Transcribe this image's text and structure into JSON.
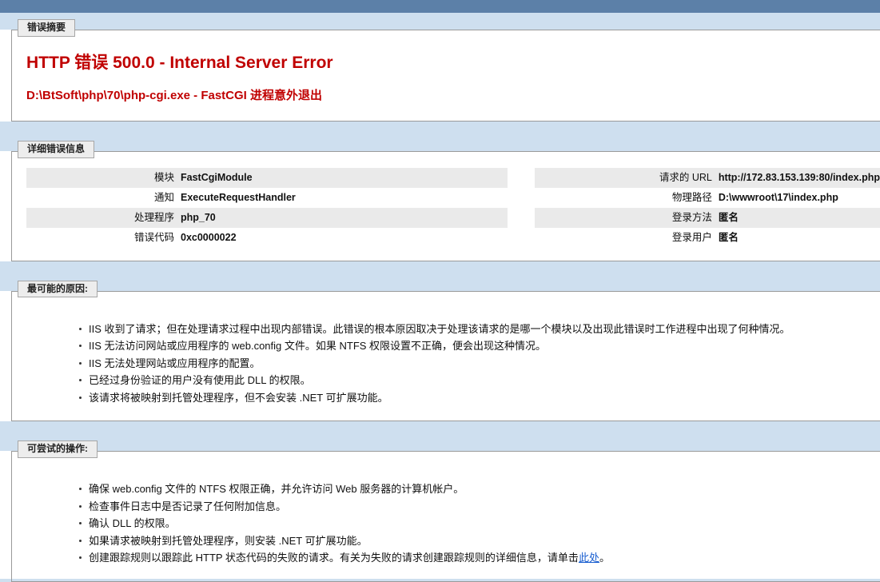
{
  "theme": {
    "banner_color": "#5c80a8",
    "page_background": "#cedfef",
    "panel_background": "#ffffff",
    "error_text_color": "#c00000",
    "row_alt_color": "#eaeaea",
    "link_color": "#1a5fd0"
  },
  "error_summary": {
    "legend": "错误摘要",
    "heading": "HTTP 错误 500.0 - Internal Server Error",
    "subheading": "D:\\BtSoft\\php\\70\\php-cgi.exe - FastCGI 进程意外退出"
  },
  "detailed_error": {
    "legend": "详细错误信息",
    "left_rows": [
      {
        "key": "模块",
        "value": "FastCgiModule"
      },
      {
        "key": "通知",
        "value": "ExecuteRequestHandler"
      },
      {
        "key": "处理程序",
        "value": "php_70"
      },
      {
        "key": "错误代码",
        "value": "0xc0000022"
      }
    ],
    "right_rows": [
      {
        "key": "请求的 URL",
        "value": "http://172.83.153.139:80/index.php"
      },
      {
        "key": "物理路径",
        "value": "D:\\wwwroot\\17\\index.php"
      },
      {
        "key": "登录方法",
        "value": "匿名"
      },
      {
        "key": "登录用户",
        "value": "匿名"
      }
    ]
  },
  "most_likely_causes": {
    "legend": "最可能的原因:",
    "items": [
      "IIS 收到了请求；但在处理请求过程中出现内部错误。此错误的根本原因取决于处理该请求的是哪一个模块以及出现此错误时工作进程中出现了何种情况。",
      "IIS 无法访问网站或应用程序的 web.config 文件。如果 NTFS 权限设置不正确，便会出现这种情况。",
      "IIS 无法处理网站或应用程序的配置。",
      "已经过身份验证的用户没有使用此 DLL 的权限。",
      "该请求将被映射到托管处理程序，但不会安装 .NET 可扩展功能。"
    ]
  },
  "things_to_try": {
    "legend": "可尝试的操作:",
    "items": [
      "确保 web.config 文件的 NTFS 权限正确，并允许访问 Web 服务器的计算机帐户。",
      "检查事件日志中是否记录了任何附加信息。",
      "确认 DLL 的权限。",
      "如果请求被映射到托管处理程序，则安装 .NET 可扩展功能。"
    ],
    "last_item": {
      "before_link": "创建跟踪规则以跟踪此 HTTP 状态代码的失败的请求。有关为失败的请求创建跟踪规则的详细信息，请单击",
      "link_text": "此处",
      "after_link": "。"
    }
  }
}
